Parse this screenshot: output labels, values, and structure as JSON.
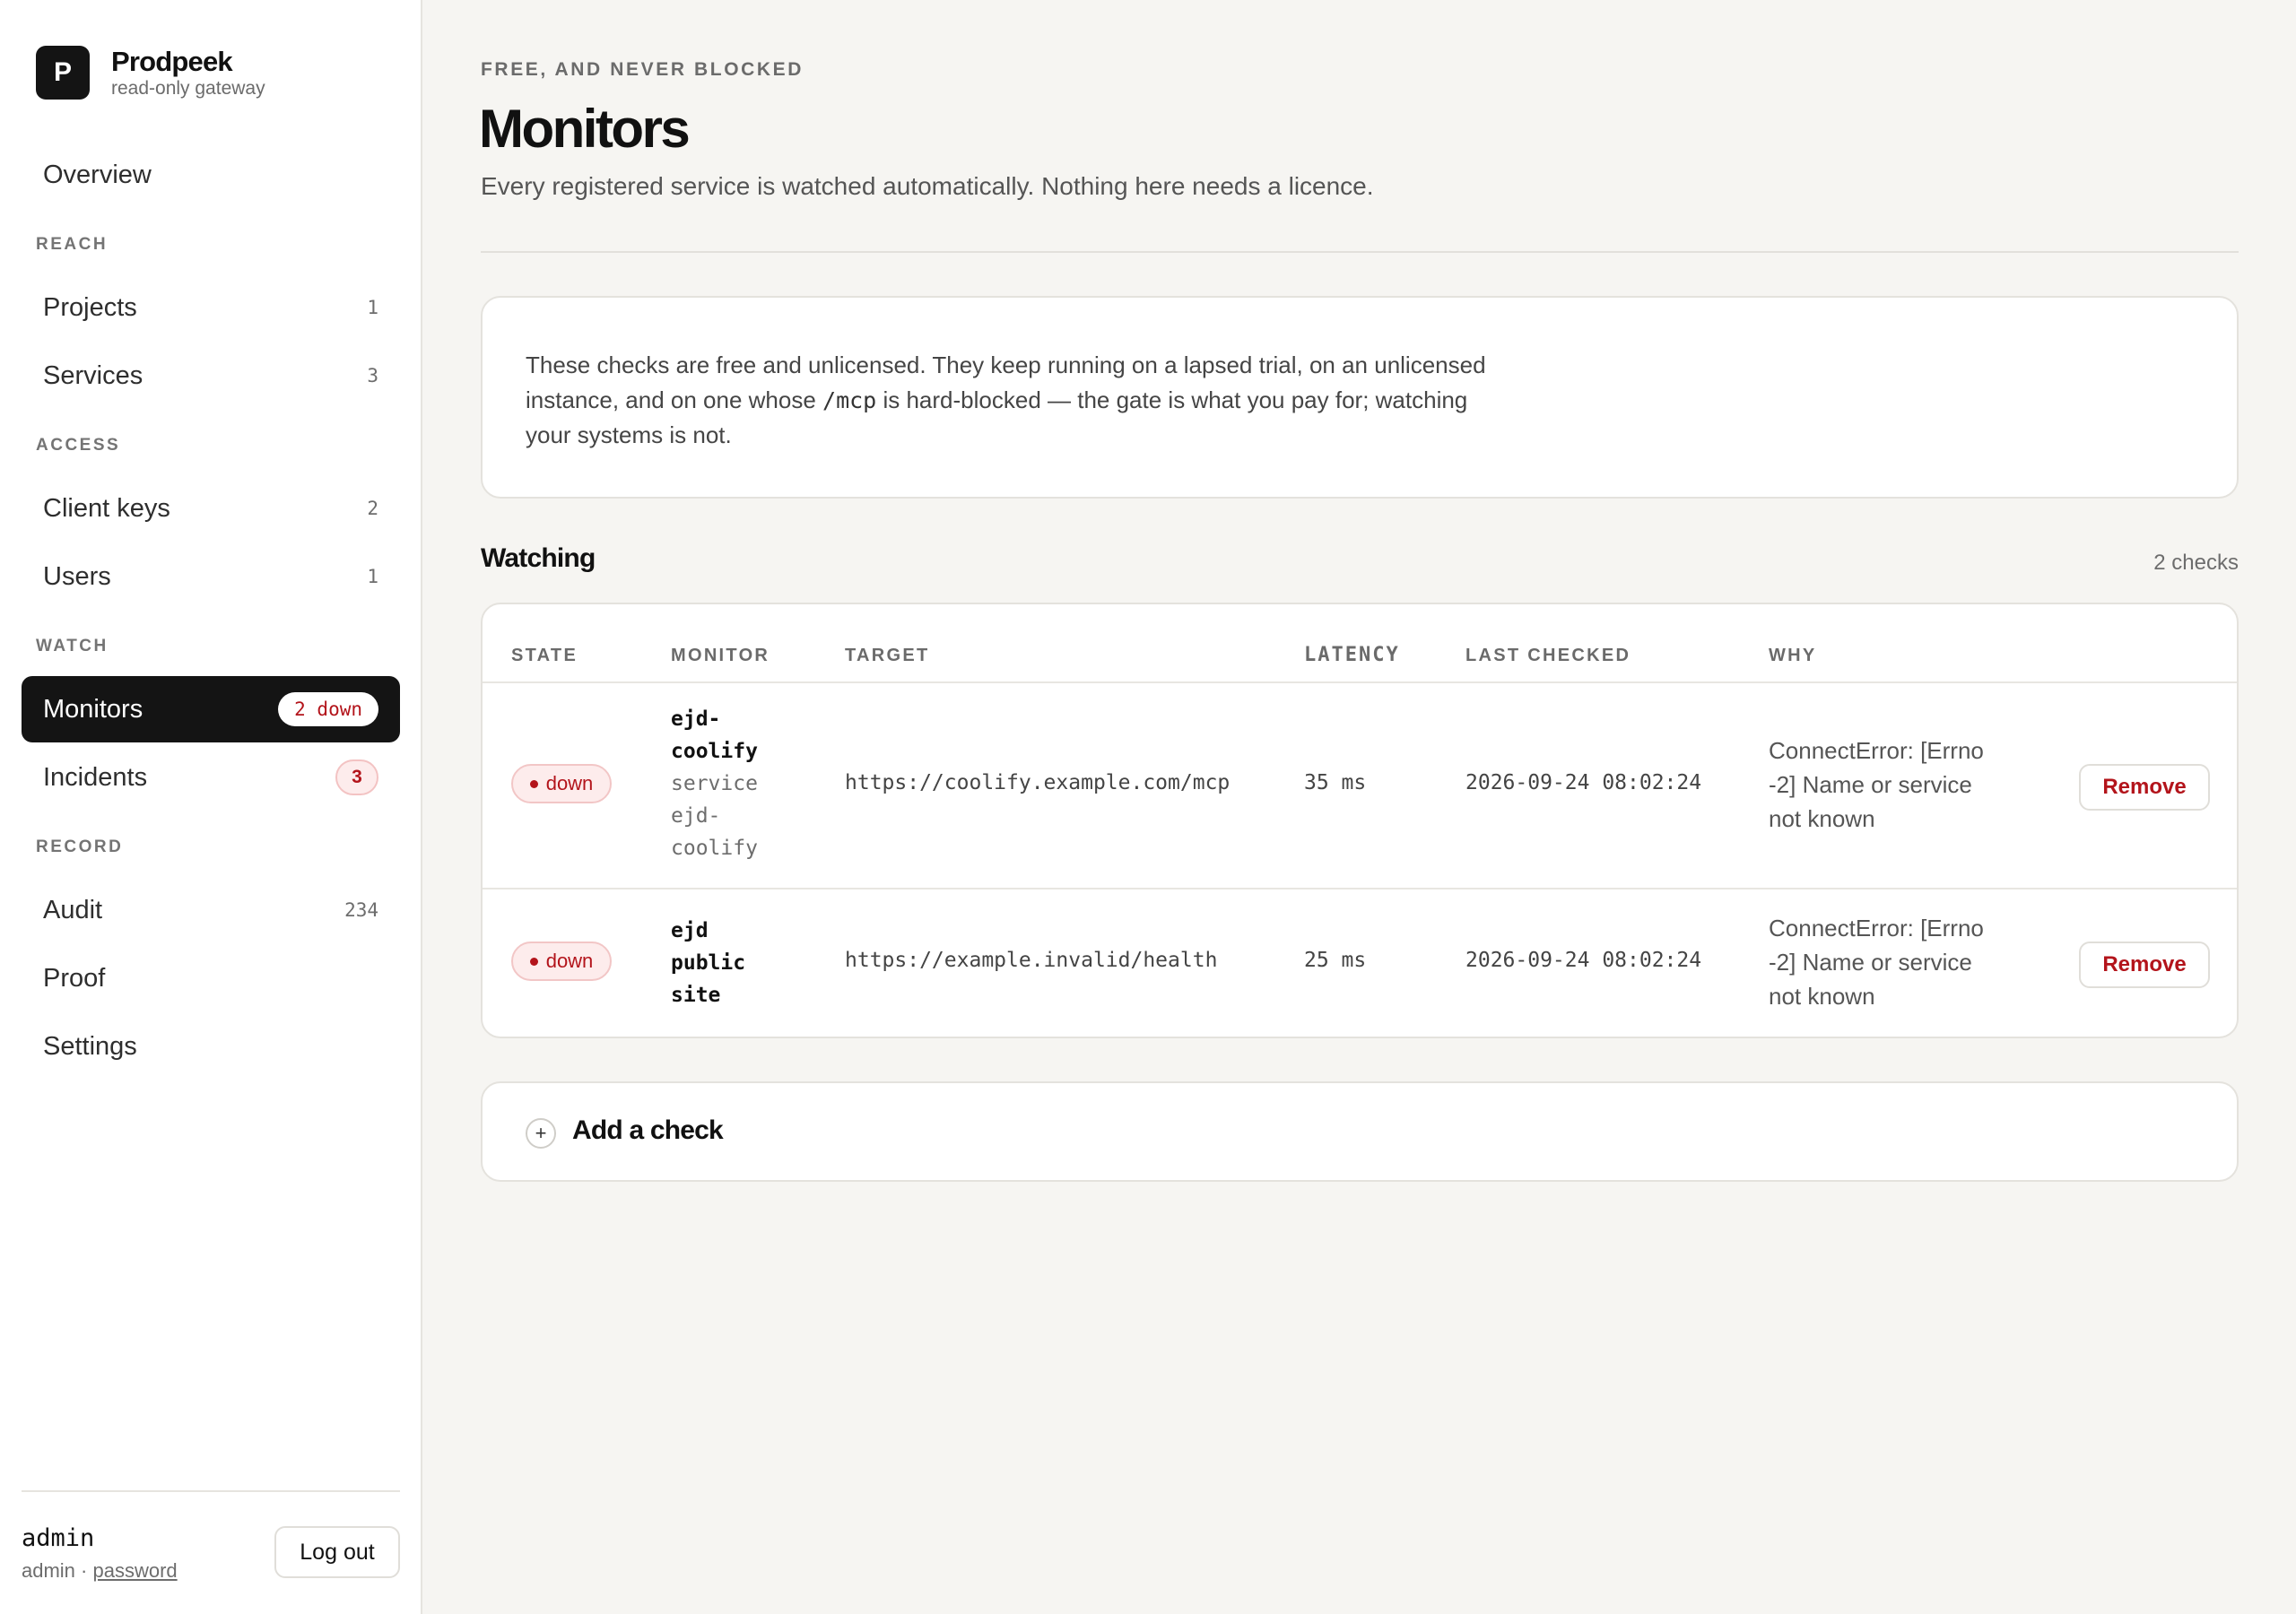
{
  "brand": {
    "logo_letter": "P",
    "name": "Prodpeek",
    "subtitle": "read-only gateway"
  },
  "nav": {
    "overview": "Overview",
    "sections": {
      "reach": "REACH",
      "access": "ACCESS",
      "watch": "WATCH",
      "record": "RECORD"
    },
    "projects": {
      "label": "Projects",
      "count": "1"
    },
    "services": {
      "label": "Services",
      "count": "3"
    },
    "client_keys": {
      "label": "Client keys",
      "count": "2"
    },
    "users": {
      "label": "Users",
      "count": "1"
    },
    "monitors": {
      "label": "Monitors",
      "badge": "2 down"
    },
    "incidents": {
      "label": "Incidents",
      "badge": "3"
    },
    "audit": {
      "label": "Audit",
      "count": "234"
    },
    "proof": {
      "label": "Proof"
    },
    "settings": {
      "label": "Settings"
    }
  },
  "user": {
    "name": "admin",
    "role": "admin",
    "separator": " · ",
    "auth_link": "password",
    "logout_label": "Log out"
  },
  "page": {
    "eyebrow": "FREE, AND NEVER BLOCKED",
    "title": "Monitors",
    "subtitle": "Every registered service is watched automatically. Nothing here needs a licence."
  },
  "info": {
    "text_before": "These checks are free and unlicensed. They keep running on a lapsed trial, on an unlicensed instance, and on one whose ",
    "code": "/mcp",
    "text_after": " is hard-blocked — the gate is what you pay for; watching your systems is not."
  },
  "watching": {
    "title": "Watching",
    "count": "2 checks",
    "columns": {
      "state": "STATE",
      "monitor": "MONITOR",
      "target": "TARGET",
      "latency": "LATENCY",
      "last_checked": "LAST CHECKED",
      "why": "WHY"
    },
    "rows": [
      {
        "state": "down",
        "name_line1": "ejd-",
        "name_line2": "coolify",
        "sub_line1": "service",
        "sub_line2": "ejd-",
        "sub_line3": "coolify",
        "target": "https://coolify.example.com/mcp",
        "latency": "35 ms",
        "last_checked": "2026-09-24 08:02:24",
        "why_line1": "ConnectError: [Errno",
        "why_line2": "-2] Name or service",
        "why_line3": "not known",
        "remove_label": "Remove"
      },
      {
        "state": "down",
        "name_line1": "ejd",
        "name_line2": "public",
        "name_line3": "site",
        "target": "https://example.invalid/health",
        "latency": "25 ms",
        "last_checked": "2026-09-24 08:02:24",
        "why_line1": "ConnectError: [Errno",
        "why_line2": "-2] Name or service",
        "why_line3": "not known",
        "remove_label": "Remove"
      }
    ]
  },
  "add_check": {
    "icon": "plus-icon",
    "label": "Add a check"
  },
  "colors": {
    "accent_dark": "#141414",
    "danger": "#b3141b",
    "background": "#f6f5f2"
  }
}
